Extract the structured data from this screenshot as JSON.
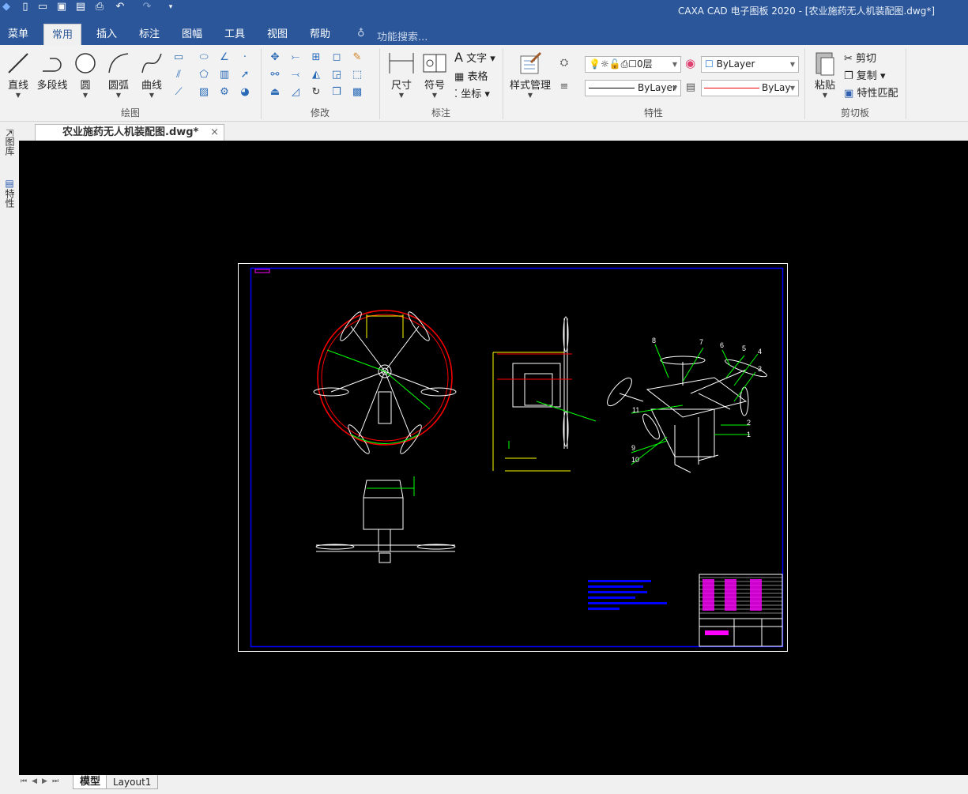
{
  "window": {
    "title": "CAXA CAD 电子图板 2020 - [农业施药无人机装配图.dwg*]"
  },
  "quick_access": [
    "app-logo-icon",
    "new-file-icon",
    "open-file-icon",
    "save-icon",
    "save-as-icon",
    "print-icon",
    "undo-icon",
    "redo-icon",
    "customize-icon"
  ],
  "menu_tabs": [
    {
      "label": "菜单"
    },
    {
      "label": "常用",
      "active": true
    },
    {
      "label": "插入"
    },
    {
      "label": "标注"
    },
    {
      "label": "图幅"
    },
    {
      "label": "工具"
    },
    {
      "label": "视图"
    },
    {
      "label": "帮助"
    }
  ],
  "search": {
    "placeholder": "功能搜索..."
  },
  "ribbon": {
    "draw": {
      "label": "绘图",
      "tools": [
        {
          "label": "直线"
        },
        {
          "label": "多段线"
        },
        {
          "label": "圆"
        },
        {
          "label": "圆弧"
        },
        {
          "label": "曲线"
        }
      ]
    },
    "modify": {
      "label": "修改"
    },
    "annotate": {
      "label": "标注",
      "dimension": "尺寸",
      "symbol": "符号",
      "text": "文字",
      "table": "表格",
      "coordinate": "坐标"
    },
    "properties": {
      "label": "特性",
      "style_manager": "样式管理",
      "layer": "0层",
      "color": "ByLayer",
      "linetype": "ByLayer",
      "lineweight": "ByLay"
    },
    "clipboard": {
      "label": "剪切板",
      "paste": "粘贴",
      "cut": "剪切",
      "copy": "复制",
      "match": "特性匹配"
    }
  },
  "document_tab": {
    "label": "农业施药无人机装配图.dwg*"
  },
  "left_panel": [
    {
      "label": "图库"
    },
    {
      "label": "特性"
    }
  ],
  "layout_tabs": [
    {
      "label": "模型",
      "active": true
    },
    {
      "label": "Layout1"
    }
  ],
  "drawing": {
    "balloons": [
      "1",
      "2",
      "3",
      "4",
      "5",
      "6",
      "7",
      "8",
      "9",
      "10",
      "11"
    ],
    "colors": {
      "frame": "#ffffff",
      "border": "#0000ff",
      "dimension": "#00ff00",
      "dim_text": "#ff0000",
      "extension": "#ffff00",
      "titleblock": "#ff00ff"
    }
  }
}
